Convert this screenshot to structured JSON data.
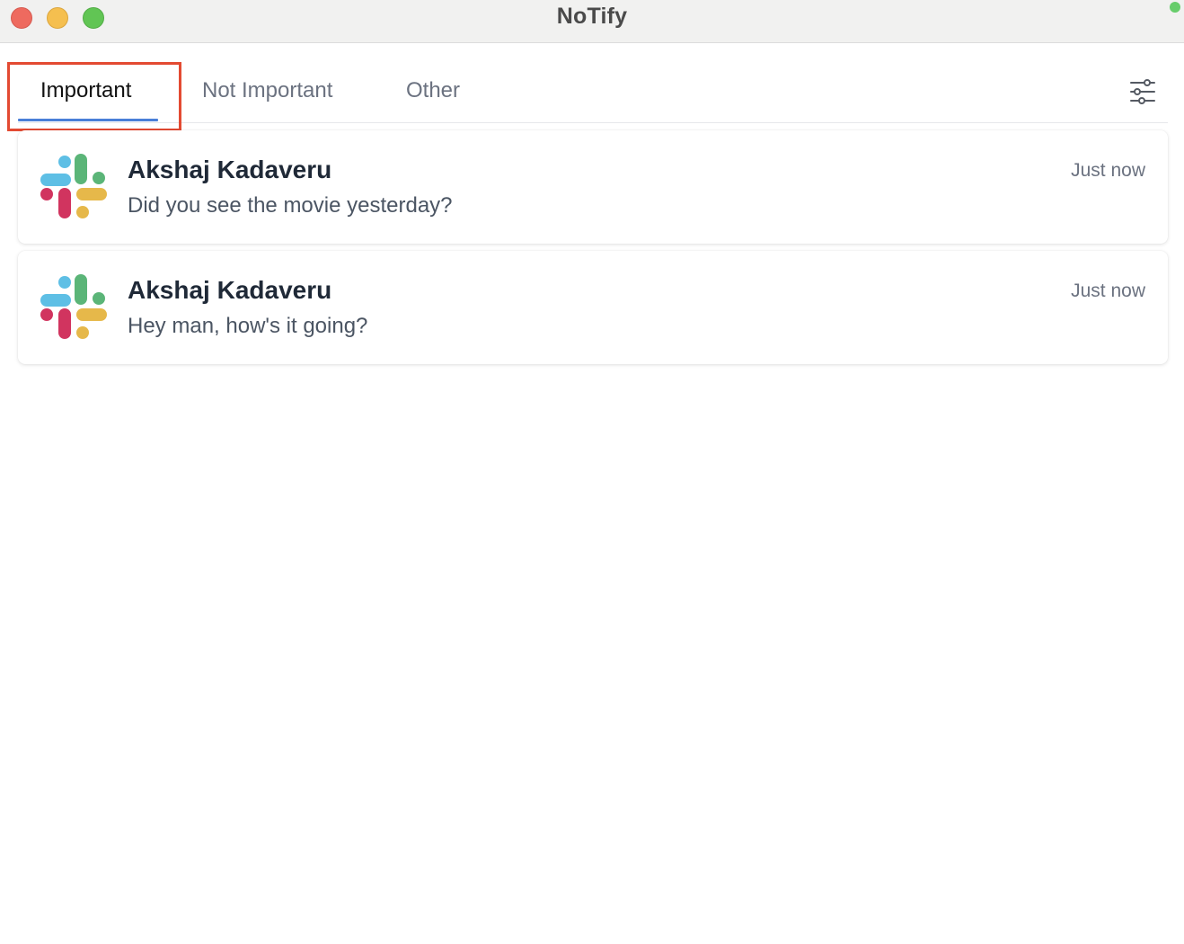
{
  "window": {
    "title": "NoTify"
  },
  "tabs": [
    {
      "label": "Important",
      "active": true
    },
    {
      "label": "Not Important",
      "active": false
    },
    {
      "label": "Other",
      "active": false
    }
  ],
  "toolbar": {
    "filter_icon": "sliders-icon"
  },
  "notifications": [
    {
      "app_icon": "slack-icon",
      "sender": "Akshaj Kadaveru",
      "message": "Did you see the movie yesterday?",
      "time": "Just now"
    },
    {
      "app_icon": "slack-icon",
      "sender": "Akshaj Kadaveru",
      "message": "Hey man, how's it going?",
      "time": "Just now"
    }
  ],
  "colors": {
    "accent": "#4a7fd8",
    "highlight": "#e34a32",
    "slack_blue": "#5ebfe5",
    "slack_green": "#5bb578",
    "slack_red": "#d1345f",
    "slack_yellow": "#e6b84a"
  }
}
